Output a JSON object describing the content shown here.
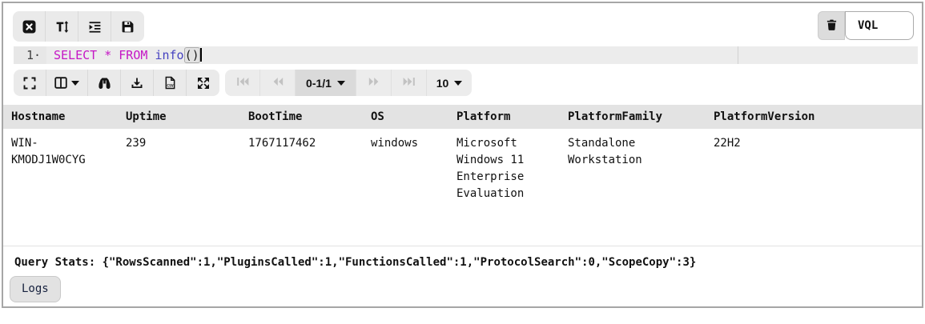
{
  "colors": {
    "keyword": "#c516c5",
    "function_name": "#4642c0",
    "toolbar_bg": "#eaeaea",
    "active_line_bg": "#ececec",
    "table_header_bg": "#e3e3e3",
    "panel_border": "#a6a6a6",
    "disabled_icon": "#c2c2c2"
  },
  "cell_toolbar": {
    "icons": [
      "close-icon",
      "text-height-icon",
      "indent-icon",
      "save-icon",
      "trash-icon"
    ],
    "cell_type_selected": "VQL"
  },
  "editor": {
    "gutter_line": "1·",
    "keyword_text": "SELECT * FROM ",
    "function_text": "info",
    "parens_text": "()"
  },
  "results_toolbar": {
    "icons": [
      "fullscreen-icon",
      "columns-icon",
      "binoculars-icon",
      "download-icon",
      "file-csv-icon",
      "arrows-expand-icon"
    ]
  },
  "pagination": {
    "icons": [
      "skip-start-icon",
      "double-left-icon",
      "double-right-icon",
      "skip-end-icon"
    ],
    "page_range": "0-1/1",
    "page_size": "10"
  },
  "table": {
    "columns": [
      "Hostname",
      "Uptime",
      "BootTime",
      "OS",
      "Platform",
      "PlatformFamily",
      "PlatformVersion"
    ],
    "rows": [
      [
        "WIN-KMODJ1W0CYG",
        "239",
        "1767117462",
        "windows",
        "Microsoft Windows 11 Enterprise Evaluation",
        "Standalone Workstation",
        "22H2"
      ]
    ]
  },
  "query_stats": "Query Stats: {\"RowsScanned\":1,\"PluginsCalled\":1,\"FunctionsCalled\":1,\"ProtocolSearch\":0,\"ScopeCopy\":3}",
  "logs_button": "Logs"
}
